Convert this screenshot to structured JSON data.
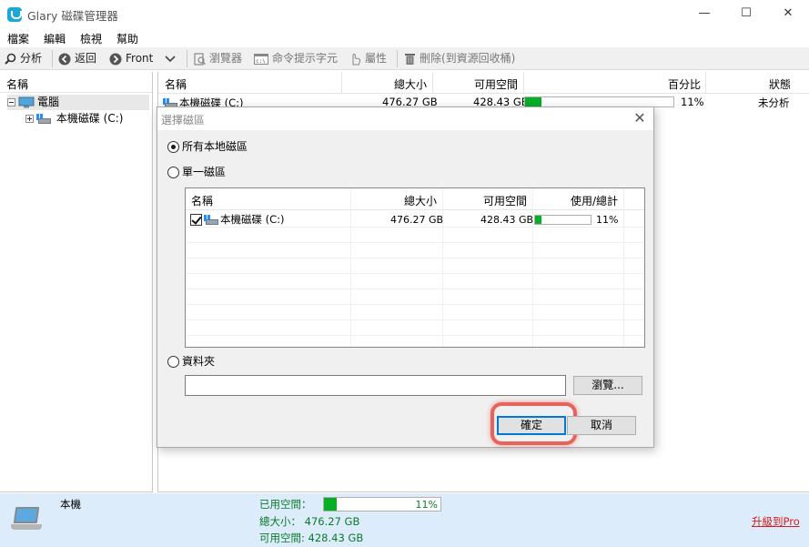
{
  "window": {
    "title": "Glary 磁碟管理器"
  },
  "window_controls": {
    "minimize": "—",
    "maximize": "☐",
    "close": "✕"
  },
  "menubar": [
    "檔案",
    "編輯",
    "檢視",
    "幫助"
  ],
  "toolbar": {
    "analyze": "分析",
    "back": "返回",
    "forward": "Front",
    "browser": "瀏覽器",
    "cmd": "命令提示字元",
    "properties": "屬性",
    "delete": "刪除(到資源回收桶)"
  },
  "left_pane": {
    "header": "名稱",
    "tree": [
      {
        "label": "電腦",
        "expander": "minus"
      },
      {
        "label": "本機磁碟 (C:)",
        "expander": "plus"
      }
    ]
  },
  "right_pane": {
    "columns": [
      "名稱",
      "總大小",
      "可用空間",
      "百分比",
      "狀態"
    ],
    "rows": [
      {
        "name": "本機磁碟 (C:)",
        "total": "476.27 GB",
        "free": "428.43 GB",
        "percent": "11%",
        "percent_value": 11,
        "status": "未分析"
      }
    ]
  },
  "dialog": {
    "title": "選擇磁區",
    "close": "✕",
    "options": {
      "all_local": "所有本地磁區",
      "single": "單一磁區",
      "folder": "資料夾"
    },
    "selected_option": "all_local",
    "drive_list": {
      "columns": [
        "名稱",
        "總大小",
        "可用空間",
        "使用/總計"
      ],
      "rows": [
        {
          "name": "本機磁碟 (C:)",
          "checked": true,
          "total": "476.27 GB",
          "free": "428.43 GB",
          "percent": "11%",
          "percent_value": 11
        }
      ]
    },
    "folder_value": "",
    "browse_button": "瀏覽...",
    "ok_button": "確定",
    "cancel_button": "取消"
  },
  "statusbar": {
    "computer_label": "本機",
    "used_label": "已用空間：",
    "used_percent": "11%",
    "used_value": 11,
    "total": "總大小： 476.27 GB",
    "free": "可用空間: 428.43 GB",
    "upgrade": "升級到Pro"
  },
  "colors": {
    "progress_fill": "#06b025",
    "accent": "#0078d7",
    "highlight": "#e8635c",
    "status_bg": "#dcecfa",
    "upgrade": "#d61c1c"
  }
}
